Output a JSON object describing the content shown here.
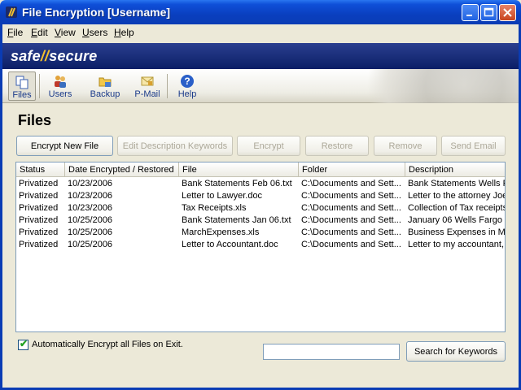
{
  "window": {
    "title": "File Encryption [Username]"
  },
  "menu": [
    "File",
    "Edit",
    "View",
    "Users",
    "Help"
  ],
  "brand": {
    "logo_left": "safe",
    "logo_sep": "//",
    "logo_right": "secure"
  },
  "toolbar": {
    "items": [
      {
        "label": "Files",
        "icon": "files-icon",
        "active": true
      },
      {
        "label": "Users",
        "icon": "users-icon"
      },
      {
        "label": "Backup",
        "icon": "backup-icon"
      },
      {
        "label": "P-Mail",
        "icon": "pmail-icon"
      },
      {
        "label": "Help",
        "icon": "help-icon"
      }
    ]
  },
  "page": {
    "title": "Files"
  },
  "actions": [
    {
      "label": "Encrypt New File",
      "enabled": true
    },
    {
      "label": "Edit Description Keywords",
      "enabled": false
    },
    {
      "label": "Encrypt",
      "enabled": false
    },
    {
      "label": "Restore",
      "enabled": false
    },
    {
      "label": "Remove",
      "enabled": false
    },
    {
      "label": "Send Email",
      "enabled": false
    }
  ],
  "table": {
    "columns": [
      "Status",
      "Date Encrypted / Restored",
      "File",
      "Folder",
      "Description"
    ],
    "rows": [
      [
        "Privatized",
        "10/23/2006",
        "Bank Statements Feb 06.txt",
        "C:\\Documents and Sett...",
        "Bank Statements Wells F"
      ],
      [
        "Privatized",
        "10/23/2006",
        "Letter to Lawyer.doc",
        "C:\\Documents and Sett...",
        "Letter to the attorney Joe"
      ],
      [
        "Privatized",
        "10/23/2006",
        "Tax Receipts.xls",
        "C:\\Documents and Sett...",
        "Collection of Tax receipts"
      ],
      [
        "Privatized",
        "10/25/2006",
        "Bank Statements Jan 06.txt",
        "C:\\Documents and Sett...",
        "January 06 Wells Fargo I"
      ],
      [
        "Privatized",
        "10/25/2006",
        "MarchExpenses.xls",
        "C:\\Documents and Sett...",
        "Business Expenses in M"
      ],
      [
        "Privatized",
        "10/25/2006",
        "Letter to Accountant.doc",
        "C:\\Documents and Sett...",
        "Letter to my accountant,"
      ]
    ]
  },
  "footer": {
    "auto_encrypt_label": "Automatically Encrypt all Files on Exit.",
    "auto_encrypt_checked": true,
    "search_value": "",
    "search_button": "Search for Keywords"
  },
  "colors": {
    "titlebar": "#0A3CB4",
    "banner": "#0B1E66",
    "accent": "#F3C02D"
  }
}
